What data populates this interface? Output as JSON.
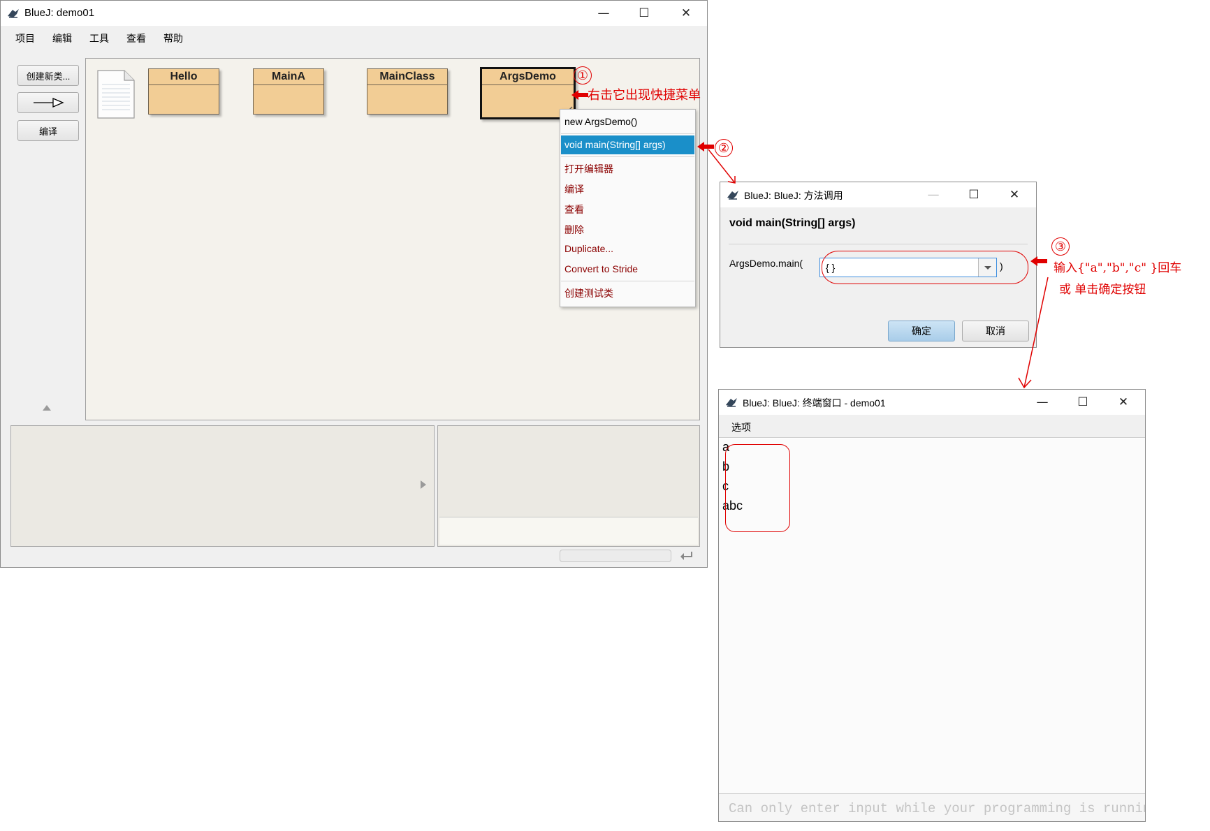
{
  "main_window": {
    "title": "BlueJ:  demo01",
    "menu": [
      "项目",
      "编辑",
      "工具",
      "查看",
      "帮助"
    ],
    "sidebar": {
      "new_class": "创建新类...",
      "compile": "编译"
    },
    "classes": [
      "Hello",
      "MainA",
      "MainClass",
      "ArgsDemo"
    ],
    "context_menu": {
      "constructor": "new ArgsDemo()",
      "main_method": "void main(String[] args)",
      "items": [
        "打开编辑器",
        "编译",
        "查看",
        "删除",
        "Duplicate...",
        "Convert to Stride"
      ],
      "create_test": "创建测试类"
    }
  },
  "dialog": {
    "title": "BlueJ:  BlueJ:  方法调用",
    "signature": "void main(String[] args)",
    "call_prefix": "ArgsDemo.main(",
    "arg_value": "{ }",
    "call_suffix": ")",
    "ok": "确定",
    "cancel": "取消"
  },
  "terminal": {
    "title": "BlueJ: BlueJ:  终端窗口 - demo01",
    "menu": "选项",
    "output": [
      "a",
      "b",
      "c",
      "abc"
    ],
    "input_placeholder": "Can only enter input while your programming is running"
  },
  "annotations": {
    "step1": "①",
    "step1_text": "右击它出现快捷菜单",
    "step2": "②",
    "step3": "③",
    "step3_line1": "输入{\"a\",\"b\",\"c\" }回车",
    "step3_line2": "或  单击确定按钮",
    "color": "#e00000"
  },
  "colors": {
    "class_fill": "#f2cd95",
    "menu_highlight": "#1a8fc9",
    "menu_red_text": "#8b0000"
  }
}
